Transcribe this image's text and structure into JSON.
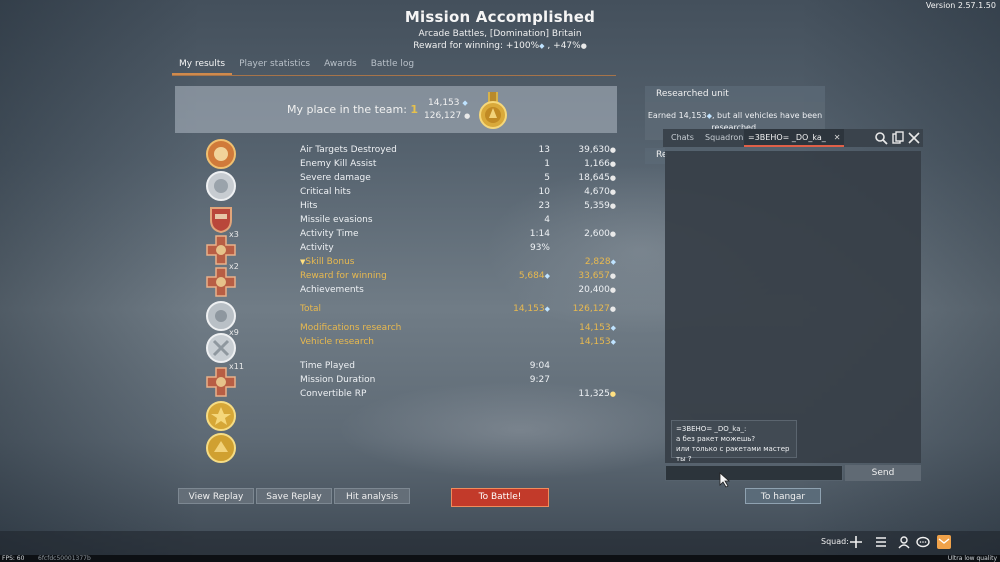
{
  "app": {
    "version": "Version 2.57.1.50"
  },
  "header": {
    "title": "Mission Accomplished",
    "subtitle": "Arcade Battles, [Domination] Britain",
    "reward_prefix": "Reward for winning: ",
    "reward_rp": "+100%",
    "reward_sep": " , ",
    "reward_sl": "+47%"
  },
  "tabs": [
    {
      "label": "My results",
      "active": true
    },
    {
      "label": "Player statistics",
      "active": false
    },
    {
      "label": "Awards",
      "active": false
    },
    {
      "label": "Battle log",
      "active": false
    }
  ],
  "place": {
    "label": "My place in the team: ",
    "value": "1",
    "rp": "14,153",
    "sl": "126,127"
  },
  "medal_multipliers": [
    "x3",
    "x2",
    "x9",
    "x11"
  ],
  "stats": [
    {
      "label": "Air Targets Destroyed",
      "c1": "13",
      "c2": "39,630",
      "c2_icon": "sl"
    },
    {
      "label": "Enemy Kill Assist",
      "c1": "1",
      "c2": "1,166",
      "c2_icon": "sl"
    },
    {
      "label": "Severe damage",
      "c1": "5",
      "c2": "18,645",
      "c2_icon": "sl"
    },
    {
      "label": "Critical hits",
      "c1": "10",
      "c2": "4,670",
      "c2_icon": "sl"
    },
    {
      "label": "Hits",
      "c1": "23",
      "c2": "5,359",
      "c2_icon": "sl"
    },
    {
      "label": "Missile evasions",
      "c1": "4",
      "c2": "",
      "c2_icon": ""
    },
    {
      "label": "Activity Time",
      "c1": "1:14",
      "c2": "2,600",
      "c2_icon": "sl"
    },
    {
      "label": "Activity",
      "c1": "93%",
      "c2": "",
      "c2_icon": ""
    },
    {
      "label": "Skill Bonus",
      "c1": "",
      "c2": "2,828",
      "c2_icon": "rp",
      "style": "skill"
    },
    {
      "label": "Reward for winning",
      "c1": "5,684",
      "c1_icon": "rp",
      "c2": "33,657",
      "c2_icon": "sl",
      "style": "gold"
    },
    {
      "label": "Achievements",
      "c1": "",
      "c2": "20,400",
      "c2_icon": "sl"
    },
    {
      "label": "Total",
      "c1": "14,153",
      "c1_icon": "rp",
      "c2": "126,127",
      "c2_icon": "sl",
      "style": "gold"
    },
    {
      "label": "Modifications research",
      "c1": "",
      "c2": "14,153",
      "c2_icon": "rp",
      "style": "gold"
    },
    {
      "label": "Vehicle research",
      "c1": "",
      "c2": "14,153",
      "c2_icon": "rp",
      "style": "gold"
    },
    {
      "label": "Time Played",
      "c1": "9:04",
      "c2": "",
      "c2_icon": ""
    },
    {
      "label": "Mission Duration",
      "c1": "9:27",
      "c2": "",
      "c2_icon": ""
    },
    {
      "label": "Convertible RP",
      "c1": "",
      "c2": "11,325",
      "c2_icon": "ge"
    }
  ],
  "researched": {
    "header": "Researched unit",
    "body_line1": "Earned 14,153",
    "body_line1b": ", but all vehicles have been",
    "body_line2": "researched.",
    "peek": "Re"
  },
  "chat": {
    "tabs": [
      {
        "label": "Chats",
        "active": false
      },
      {
        "label": "Squadron",
        "active": false
      },
      {
        "label": "=3BEHO= _DO_ka_",
        "active": true
      }
    ],
    "message_author": "=3BEHO= _DO_ka_:",
    "message_line1": "а без ракет можешь?",
    "message_line2": "или только с ракетами мастер ты ?",
    "input_value": "",
    "send_label": "Send"
  },
  "buttons": {
    "view_replay": "View Replay",
    "save_replay": "Save Replay",
    "hit_analysis": "Hit analysis",
    "to_battle": "To Battle!",
    "to_hangar": "To hangar"
  },
  "bottom": {
    "squad_label": "Squad:"
  },
  "status": {
    "fps": "FPS: 60",
    "hash": "6fcfdc50001377b",
    "quality": "Ultra low quality"
  },
  "colors": {
    "accent_orange": "#d08a4c",
    "gold_text": "#e8b94f",
    "battle_red": "#c23a2a"
  }
}
